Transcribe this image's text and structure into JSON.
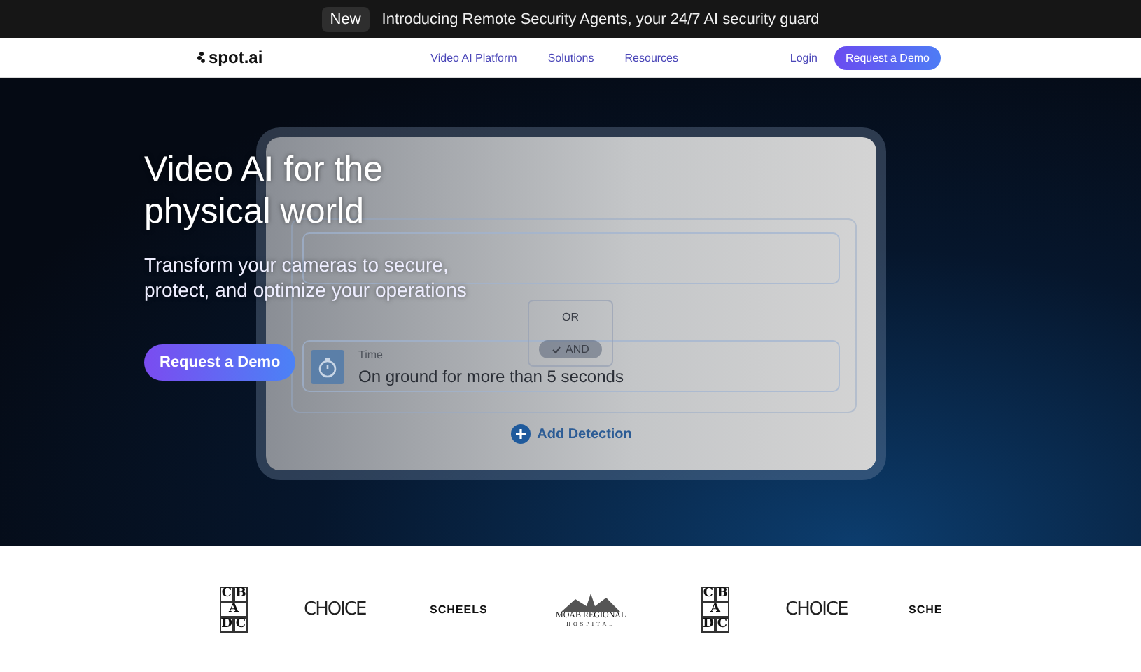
{
  "banner": {
    "badge": "New",
    "text": "Introducing Remote Security Agents, your 24/7 AI security guard"
  },
  "nav": {
    "logo": "spot.ai",
    "links": [
      "Video AI Platform",
      "Solutions",
      "Resources"
    ],
    "login": "Login",
    "cta": "Request a Demo"
  },
  "hero": {
    "title": "Video AI for the physical world",
    "subtitle": "Transform your cameras to secure, protect, and optimize your operations",
    "cta": "Request a Demo",
    "mockup": {
      "operators": [
        {
          "label": "OR",
          "selected": false
        },
        {
          "label": "AND",
          "selected": true
        }
      ],
      "condition": {
        "label": "Time",
        "value": "On ground for more than 5 seconds"
      },
      "add": "Add Detection"
    }
  },
  "logos": [
    {
      "kind": "blocks",
      "letters": [
        "C",
        "B",
        "A",
        "D",
        "C"
      ]
    },
    {
      "kind": "script",
      "text": "CHOICE"
    },
    {
      "kind": "bold",
      "text": "SCHEELS"
    },
    {
      "kind": "hospital",
      "text": "MOAB REGIONAL",
      "sub": "HOSPITAL"
    },
    {
      "kind": "blocks",
      "letters": [
        "C",
        "B",
        "A",
        "D",
        "C"
      ]
    },
    {
      "kind": "script",
      "text": "CHOICE"
    },
    {
      "kind": "bold",
      "text": "SCHE"
    }
  ]
}
